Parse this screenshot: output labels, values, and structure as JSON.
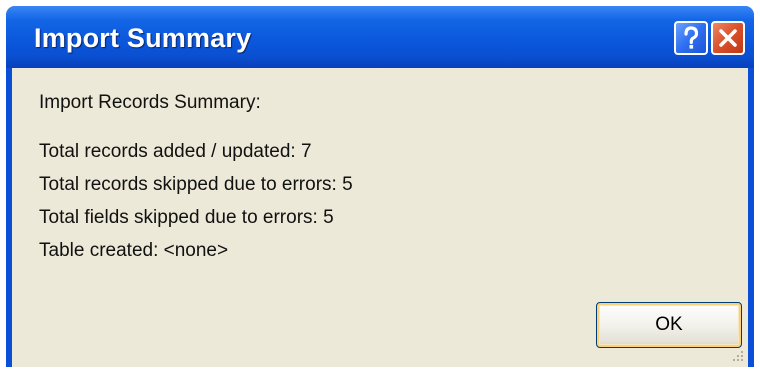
{
  "dialog": {
    "title": "Import Summary",
    "help_icon": "question-mark-icon",
    "close_icon": "close-x-icon"
  },
  "summary": {
    "heading": "Import Records Summary:",
    "lines": [
      "Total records added / updated: 7",
      "Total records skipped due to errors: 5",
      "Total fields skipped due to errors: 5",
      "Table created: <none>"
    ]
  },
  "buttons": {
    "ok_label": "OK"
  },
  "colors": {
    "titlebar": "#0a58de",
    "window_background": "#ece9d8",
    "close_button": "#d9502a",
    "help_button": "#2f6ff0"
  }
}
